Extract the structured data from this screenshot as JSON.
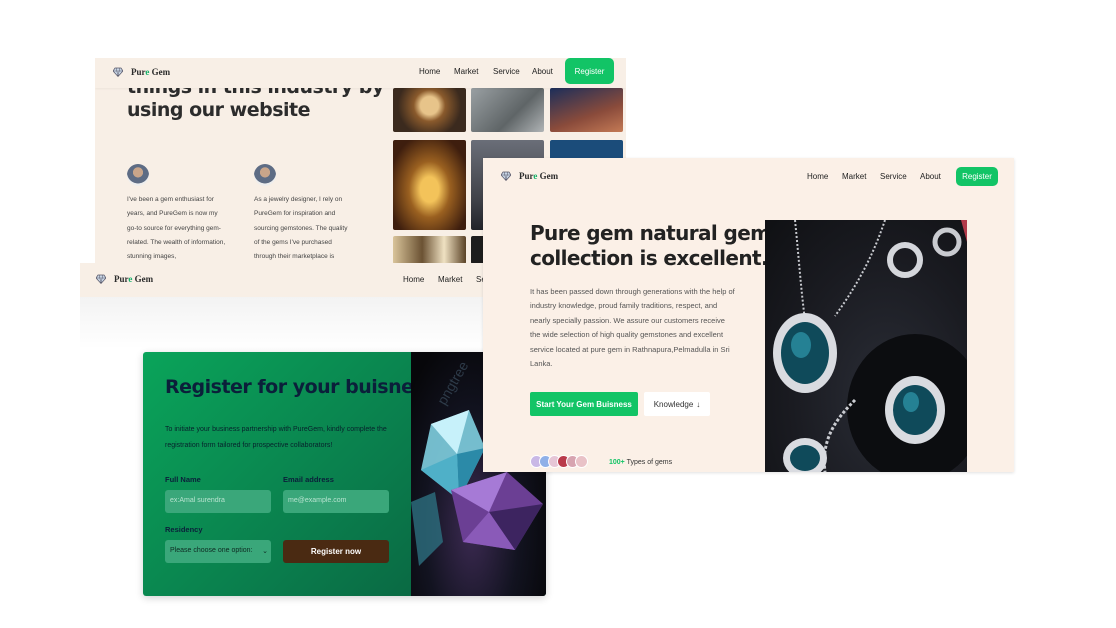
{
  "brand": {
    "name_a": "Pur",
    "name_b": "e",
    "name_c": " Gem"
  },
  "nav": {
    "home": "Home",
    "market": "Market",
    "service": "Service",
    "about": "About",
    "register": "Register",
    "service_cut": "Se"
  },
  "testimonials_section": {
    "heading_line1": "things in this industry by",
    "heading_line2": "using our website",
    "items": [
      {
        "text": "I've been a gem enthusiast for years, and PureGem is now my go-to source for everything gem-related. The wealth of information, stunning images,"
      },
      {
        "text": "As a jewelry designer, I rely on PureGem for inspiration and sourcing gemstones. The quality of the gems I've purchased through their marketplace is"
      }
    ]
  },
  "register_section": {
    "title": "Register for your buisness!",
    "intro": "To initiate your business partnership with PureGem, kindly complete the registration form tailored for prospective collaborators!",
    "full_name_label": "Full Name",
    "full_name_placeholder": "ex:Amal surendra",
    "email_label": "Email address",
    "email_placeholder": "me@example.com",
    "residency_label": "Residency",
    "residency_selected": "Please choose one option:",
    "submit_label": "Register now",
    "watermark": "pngtree"
  },
  "hero_section": {
    "title_line1": "Pure gem natural gem",
    "title_line2": "collection is excellent.",
    "description": "It has been passed down through generations with the help of industry knowledge, proud family traditions, respect, and nearly specially passion. We assure our customers receive the wide selection of high quality gemstones and excellent service located at pure gem in Rathnapura,Pelmadulla in Sri Lanka.",
    "cta_primary": "Start Your Gem Buisness",
    "cta_secondary": "Knowledge",
    "cta_secondary_arrow": "↓",
    "types_count": "100+",
    "types_label": " Types of gems"
  },
  "colors": {
    "accent": "#12c466",
    "cream": "#f8efe6",
    "dark_brown": "#4a2a12",
    "navy": "#0b1f3a"
  }
}
